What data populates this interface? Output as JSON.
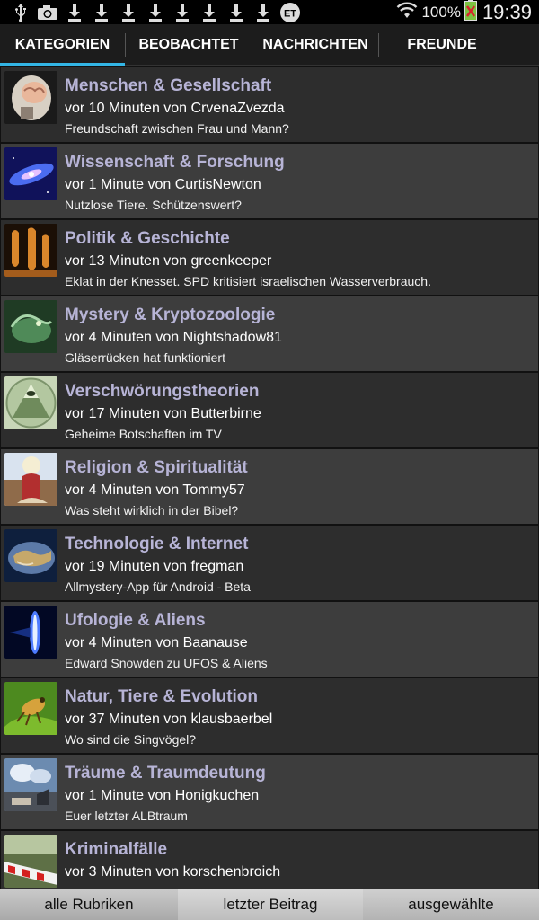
{
  "status_bar": {
    "battery": "100%",
    "time": "19:39",
    "notification_icons": [
      "usb-icon",
      "camera-icon",
      "download-icon",
      "download-icon",
      "download-icon",
      "download-icon",
      "download-icon",
      "download-icon",
      "download-icon",
      "download-icon",
      "et-icon"
    ]
  },
  "tabs": [
    {
      "label": "KATEGORIEN",
      "active": true
    },
    {
      "label": "BEOBACHTET",
      "active": false
    },
    {
      "label": "NACHRICHTEN",
      "active": false
    },
    {
      "label": "FREUNDE",
      "active": false
    }
  ],
  "categories": [
    {
      "title": "Menschen & Gesellschaft",
      "meta": "vor 10 Minuten von CrvenaZvezda",
      "subtitle": "Freundschaft zwischen Frau und Mann?",
      "icon": "brain-scan-icon"
    },
    {
      "title": "Wissenschaft & Forschung",
      "meta": "vor 1 Minute von CurtisNewton",
      "subtitle": "Nutzlose Tiere. Schützenswert?",
      "icon": "galaxy-icon"
    },
    {
      "title": "Politik & Geschichte",
      "meta": "vor 13 Minuten von greenkeeper",
      "subtitle": "Eklat in der Knesset. SPD kritisiert israelischen Wasserverbrauch.",
      "icon": "ancient-vase-icon"
    },
    {
      "title": "Mystery & Kryptozoologie",
      "meta": "vor 4 Minuten von Nightshadow81",
      "subtitle": "Gläserrücken hat funktioniert",
      "icon": "creature-icon"
    },
    {
      "title": "Verschwörungstheorien",
      "meta": "vor 17 Minuten von Butterbirne",
      "subtitle": "Geheime Botschaften im TV",
      "icon": "pyramid-eye-icon"
    },
    {
      "title": "Religion & Spiritualität",
      "meta": "vor 4 Minuten von Tommy57",
      "subtitle": "Was steht wirklich in der Bibel?",
      "icon": "religious-painting-icon"
    },
    {
      "title": "Technologie & Internet",
      "meta": "vor 19 Minuten von fregman",
      "subtitle": "Allmystery-App für Android - Beta",
      "icon": "globe-icon"
    },
    {
      "title": "Ufologie & Aliens",
      "meta": "vor 4 Minuten von Baanause",
      "subtitle": "Edward Snowden zu UFOS & Aliens",
      "icon": "ufo-light-icon"
    },
    {
      "title": "Natur, Tiere & Evolution",
      "meta": "vor 37 Minuten von klausbaerbel",
      "subtitle": "Wo sind die Singvögel?",
      "icon": "insect-icon"
    },
    {
      "title": "Träume & Traumdeutung",
      "meta": "vor 1 Minute von Honigkuchen",
      "subtitle": "Euer letzter ALBtraum",
      "icon": "dream-scene-icon"
    },
    {
      "title": "Kriminalfälle",
      "meta": "vor 3 Minuten von korschenbroich",
      "subtitle": "",
      "icon": "police-tape-icon"
    }
  ],
  "bottom_bar": [
    "alle Rubriken",
    "letzter Beitrag",
    "ausgewählte"
  ],
  "colors": {
    "accent": "#33b5e5",
    "title": "#b7b4d6"
  }
}
